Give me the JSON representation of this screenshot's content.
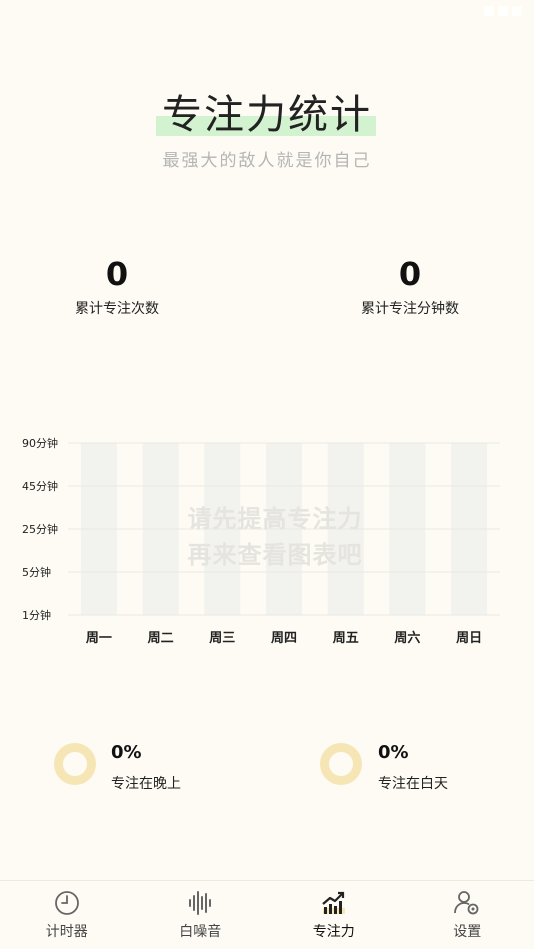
{
  "header": {
    "title": "专注力统计",
    "subtitle": "最强大的敌人就是你自己"
  },
  "stats": {
    "total_sessions": {
      "value": "0",
      "label": "累计专注次数"
    },
    "total_minutes": {
      "value": "0",
      "label": "累计专注分钟数"
    }
  },
  "chart_data": {
    "type": "bar",
    "categories": [
      "周一",
      "周二",
      "周三",
      "周四",
      "周五",
      "周六",
      "周日"
    ],
    "values": [
      0,
      0,
      0,
      0,
      0,
      0,
      0
    ],
    "ytick_labels": [
      "1分钟",
      "5分钟",
      "25分钟",
      "45分钟",
      "90分钟"
    ],
    "empty_message_line1": "请先提高专注力",
    "empty_message_line2": "再来查看图表吧"
  },
  "time_of_day": {
    "night": {
      "percent": "0%",
      "label": "专注在晚上"
    },
    "day": {
      "percent": "0%",
      "label": "专注在白天"
    }
  },
  "tabs": [
    {
      "label": "计时器",
      "icon": "clock-icon",
      "active": false
    },
    {
      "label": "白噪音",
      "icon": "sound-wave-icon",
      "active": false
    },
    {
      "label": "专注力",
      "icon": "chart-trend-icon",
      "active": true
    },
    {
      "label": "设置",
      "icon": "user-settings-icon",
      "active": false
    }
  ],
  "colors": {
    "background": "#fdfbf4",
    "title_highlight": "#d3f2cf",
    "ring": "#f7e6b5",
    "chart_bar_placeholder": "#f2f2ee"
  }
}
